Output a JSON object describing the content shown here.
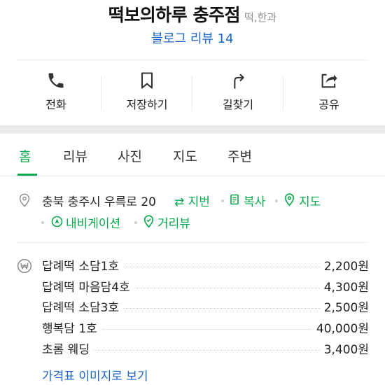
{
  "header": {
    "title": "떡보의하루 충주점",
    "category": "떡,한과",
    "review_link": "블로그 리뷰 14"
  },
  "actions": [
    {
      "label": "전화",
      "icon": "phone-icon"
    },
    {
      "label": "저장하기",
      "icon": "bookmark-icon"
    },
    {
      "label": "길찾기",
      "icon": "directions-icon"
    },
    {
      "label": "공유",
      "icon": "share-icon"
    }
  ],
  "tabs": [
    {
      "label": "홈",
      "active": true
    },
    {
      "label": "리뷰",
      "active": false
    },
    {
      "label": "사진",
      "active": false
    },
    {
      "label": "지도",
      "active": false
    },
    {
      "label": "주변",
      "active": false
    }
  ],
  "address": {
    "text": "충북 충주시 우륵로 20",
    "lot_address": "⇄ 지번",
    "copy": "복사",
    "map": "지도",
    "navigation": "내비게이션",
    "street_view": "거리뷰"
  },
  "menu": {
    "items": [
      {
        "name": "답례떡 소담1호",
        "price": "2,200원"
      },
      {
        "name": "답례떡 마음담4호",
        "price": "4,300원"
      },
      {
        "name": "답례떡 소담3호",
        "price": "2,500원"
      },
      {
        "name": "행복담 1호",
        "price": "40,000원"
      },
      {
        "name": "초롬 웨딩",
        "price": "3,400원"
      }
    ],
    "more_link": "가격표 이미지로 보기"
  },
  "colors": {
    "accent_green": "#05a84a",
    "link_blue": "#1a63c8",
    "muted_gray": "#8f8f8f"
  }
}
